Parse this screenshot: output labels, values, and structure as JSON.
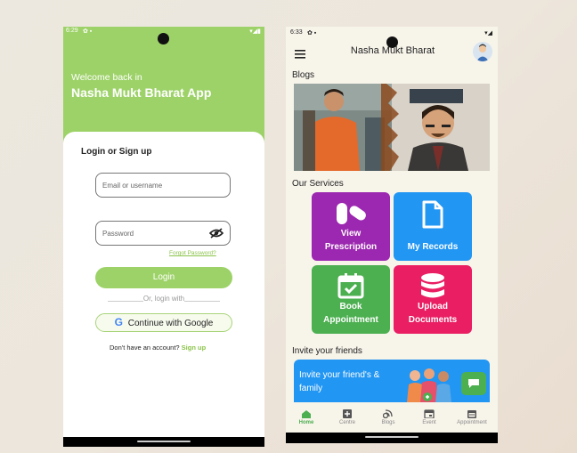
{
  "login_screen": {
    "status_time": "6:29",
    "welcome": "Welcome back in",
    "app_name": "Nasha Mukt Bharat App",
    "heading": "Login or Sign up",
    "email_placeholder": "Email or username",
    "password_placeholder": "Password",
    "forgot": "Forgot Password?",
    "login_button": "Login",
    "divider": "Or, login with",
    "google_button": "Continue with Google",
    "no_account": "Don't have an account?",
    "signup": "Sign up",
    "accent_color": "#9dd268"
  },
  "home_screen": {
    "status_time": "6:33",
    "title": "Nasha Mukt Bharat",
    "blogs_heading": "Blogs",
    "services_heading": "Our Services",
    "services": [
      {
        "label_line1": "View",
        "label_line2": "Prescription",
        "icon": "pills-icon",
        "color": "#9c27b0"
      },
      {
        "label_line1": "",
        "label_line2": "My Records",
        "icon": "document-icon",
        "color": "#2196f3"
      },
      {
        "label_line1": "Book",
        "label_line2": "Appointment",
        "icon": "calendar-check-icon",
        "color": "#4caf50"
      },
      {
        "label_line1": "Upload",
        "label_line2": "Documents",
        "icon": "database-icon",
        "color": "#e91e63"
      }
    ],
    "invite_heading": "Invite your friends",
    "invite_text_line1": "Invite your friend's &",
    "invite_text_line2": "family",
    "nav": [
      {
        "label": "Home",
        "icon": "home-icon",
        "active": true
      },
      {
        "label": "Centre",
        "icon": "plus-box-icon",
        "active": false
      },
      {
        "label": "Blogs",
        "icon": "blog-icon",
        "active": false
      },
      {
        "label": "Event",
        "icon": "event-icon",
        "active": false
      },
      {
        "label": "Appointment",
        "icon": "calendar-icon",
        "active": false
      }
    ]
  }
}
